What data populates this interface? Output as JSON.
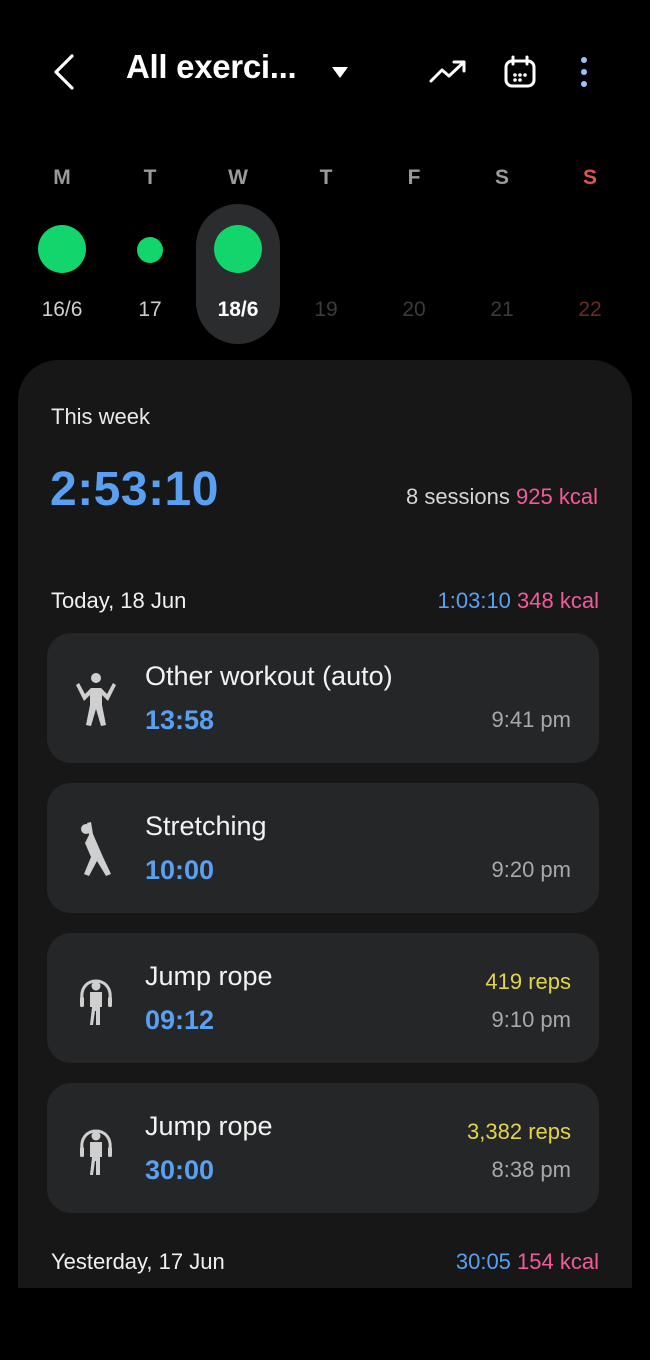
{
  "header": {
    "title": "All exerci...",
    "icons": [
      "back-chevron",
      "dropdown-caret",
      "trend-icon",
      "calendar-icon",
      "more-icon"
    ]
  },
  "week": {
    "days": [
      {
        "letter": "M",
        "date": "16/6"
      },
      {
        "letter": "T",
        "date": "17"
      },
      {
        "letter": "W",
        "date": "18/6"
      },
      {
        "letter": "T",
        "date": "19"
      },
      {
        "letter": "F",
        "date": "20"
      },
      {
        "letter": "S",
        "date": "21"
      },
      {
        "letter": "S",
        "date": "22"
      }
    ],
    "selected_index": 2
  },
  "summary": {
    "label": "This week",
    "total": "2:53:10",
    "sessions_count": "8",
    "sessions_word": "sessions",
    "kcal_value": "925",
    "kcal_unit": "kcal"
  },
  "today": {
    "label": "Today, 18 Jun",
    "duration": "1:03:10",
    "kcal": "348 kcal"
  },
  "workouts": [
    {
      "name": "Other workout (auto)",
      "duration": "13:58",
      "time": "9:41 pm",
      "reps": "",
      "icon": "person-standing-icon"
    },
    {
      "name": "Stretching",
      "duration": "10:00",
      "time": "9:20 pm",
      "reps": "",
      "icon": "stretching-icon"
    },
    {
      "name": "Jump rope",
      "duration": "09:12",
      "time": "9:10 pm",
      "reps": "419 reps",
      "icon": "jump-rope-icon"
    },
    {
      "name": "Jump rope",
      "duration": "30:00",
      "time": "8:38 pm",
      "reps": "3,382 reps",
      "icon": "jump-rope-icon"
    }
  ],
  "yesterday": {
    "label": "Yesterday, 17 Jun",
    "duration": "30:05",
    "kcal": "154 kcal"
  },
  "colors": {
    "accent_blue": "#5aa0f2",
    "kcal_pink": "#f15b9b",
    "reps_yellow": "#e3d54a",
    "activity_green": "#12d56c",
    "sunday_red": "#e0564f"
  }
}
